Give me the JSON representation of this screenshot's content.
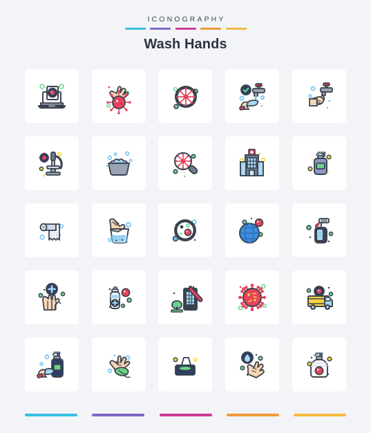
{
  "header": {
    "eyebrow": "ICONOGRAPHY",
    "title": "Wash Hands",
    "accent_bars": [
      {
        "name": "bar-cyan",
        "color": "#35c0e0"
      },
      {
        "name": "bar-purple",
        "color": "#7f68c9"
      },
      {
        "name": "bar-magenta",
        "color": "#cc3d95"
      },
      {
        "name": "bar-orange",
        "color": "#ef9a3a"
      },
      {
        "name": "bar-yellow",
        "color": "#f3bb3f"
      }
    ]
  },
  "footer": {
    "bars": [
      {
        "name": "bar-cyan",
        "color": "#35c0e0"
      },
      {
        "name": "bar-purple",
        "color": "#7f68c9"
      },
      {
        "name": "bar-magenta",
        "color": "#cc3d95"
      },
      {
        "name": "bar-orange",
        "color": "#ef9a3a"
      },
      {
        "name": "bar-yellow",
        "color": "#f3bb3f"
      }
    ]
  },
  "palette": {
    "background": "#f2f4f8",
    "card": "#ffffff",
    "outline": "#3b4350",
    "skin": "#f7d7b4",
    "water": "#a9d8f5",
    "water_deep": "#6ec0f0",
    "virus_red": "#e8435c",
    "green": "#6cd48a",
    "yellow": "#f6d53d",
    "navy": "#2e3f63",
    "steel": "#6f7b8c",
    "title_text": "#2b3242",
    "eyebrow_text": "#3c4250"
  },
  "grid": {
    "columns": 5,
    "rows": 5,
    "count": 25,
    "icons": [
      {
        "id": 1,
        "name": "laptop-virus-scan-icon",
        "label": "Laptop showing virus",
        "row": 1,
        "col": 1
      },
      {
        "id": 2,
        "name": "hands-virus-icon",
        "label": "Hands with virus",
        "row": 1,
        "col": 2
      },
      {
        "id": 3,
        "name": "virus-circle-icon",
        "label": "Virus in dark circle",
        "row": 1,
        "col": 3
      },
      {
        "id": 4,
        "name": "faucet-hand-check-icon",
        "label": "Faucet, hand and check mark",
        "row": 1,
        "col": 4
      },
      {
        "id": 5,
        "name": "faucet-washing-hands-icon",
        "label": "Washing hands under faucet",
        "row": 1,
        "col": 5
      },
      {
        "id": 6,
        "name": "microscope-virus-icon",
        "label": "Microscope with virus",
        "row": 2,
        "col": 1
      },
      {
        "id": 7,
        "name": "wash-basin-bubbles-icon",
        "label": "Wash basin with bubbles",
        "row": 2,
        "col": 2
      },
      {
        "id": 8,
        "name": "magnifier-virus-icon",
        "label": "Magnifying glass on virus",
        "row": 2,
        "col": 3
      },
      {
        "id": 9,
        "name": "hospital-building-icon",
        "label": "Hospital building",
        "row": 2,
        "col": 4
      },
      {
        "id": 10,
        "name": "soap-dispenser-bottle-icon",
        "label": "Soap dispenser bottle",
        "row": 2,
        "col": 5
      },
      {
        "id": 11,
        "name": "toilet-paper-roll-icon",
        "label": "Toilet paper roll",
        "row": 3,
        "col": 1
      },
      {
        "id": 12,
        "name": "hands-in-water-basin-icon",
        "label": "Hands washing in basin",
        "row": 3,
        "col": 2
      },
      {
        "id": 13,
        "name": "petri-dish-culture-icon",
        "label": "Petri dish with microbes",
        "row": 3,
        "col": 3
      },
      {
        "id": 14,
        "name": "globe-virus-icon",
        "label": "Globe with virus",
        "row": 3,
        "col": 4
      },
      {
        "id": 15,
        "name": "spray-bottle-icon",
        "label": "Disinfectant spray bottle",
        "row": 3,
        "col": 5
      },
      {
        "id": 16,
        "name": "hands-medical-plus-icon",
        "label": "Hands with medical plus",
        "row": 4,
        "col": 1
      },
      {
        "id": 17,
        "name": "sanitizer-bottle-virus-icon",
        "label": "Sanitizer bottle and virus",
        "row": 4,
        "col": 2
      },
      {
        "id": 18,
        "name": "building-closed-icon",
        "label": "Building with red slash",
        "row": 4,
        "col": 3
      },
      {
        "id": 19,
        "name": "virus-large-icon",
        "label": "Large virus cell",
        "row": 4,
        "col": 4
      },
      {
        "id": 20,
        "name": "delivery-truck-virus-icon",
        "label": "Delivery truck with virus",
        "row": 4,
        "col": 5
      },
      {
        "id": 21,
        "name": "hand-soap-pump-icon",
        "label": "Hand with soap pump bottle",
        "row": 5,
        "col": 1
      },
      {
        "id": 22,
        "name": "hands-drying-towel-icon",
        "label": "Hands drying with towel",
        "row": 5,
        "col": 2
      },
      {
        "id": 23,
        "name": "tissue-box-icon",
        "label": "Tissue box",
        "row": 5,
        "col": 3
      },
      {
        "id": 24,
        "name": "water-drop-hands-icon",
        "label": "Water drop with hands",
        "row": 5,
        "col": 4
      },
      {
        "id": 25,
        "name": "soap-bottle-virus-icon",
        "label": "Soap bottle with virus",
        "row": 5,
        "col": 5
      }
    ]
  }
}
